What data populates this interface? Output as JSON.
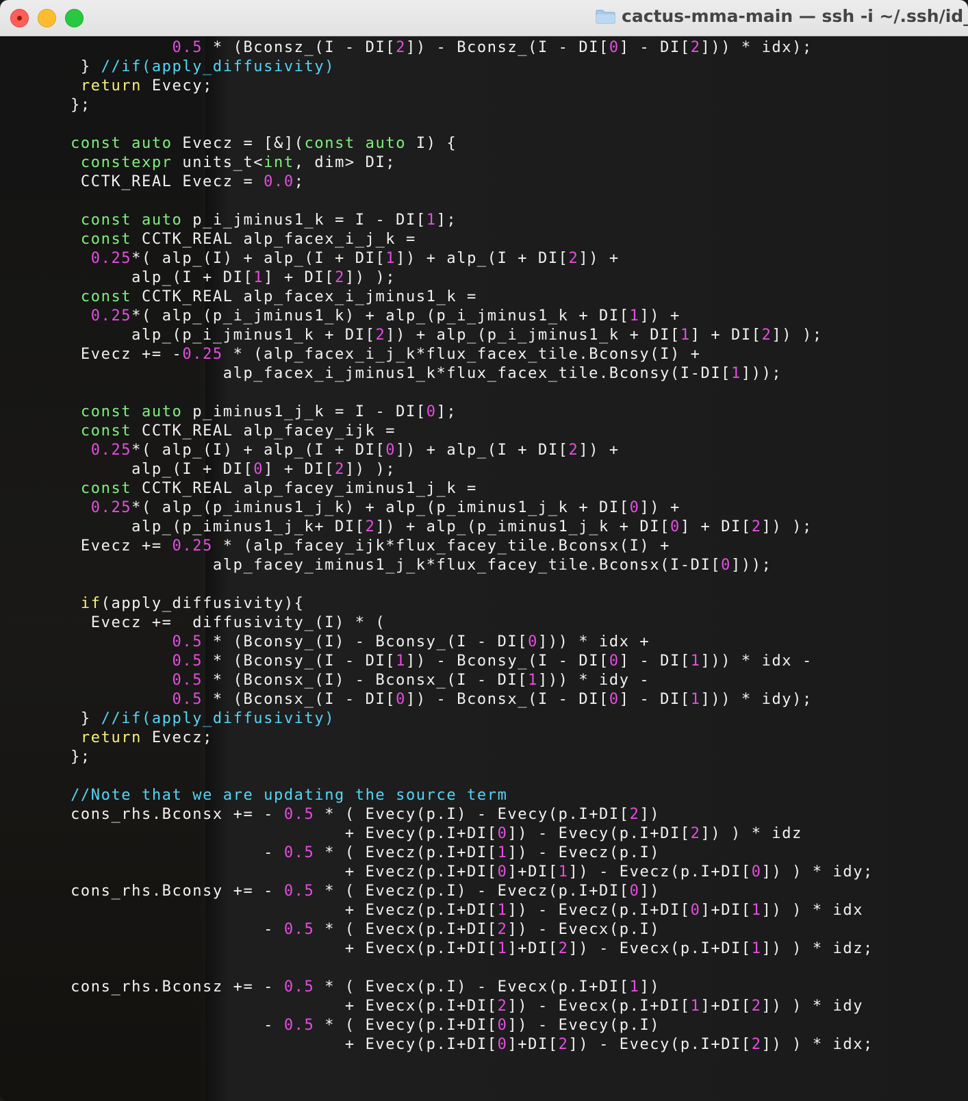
{
  "window": {
    "title": "cactus-mma-main — ssh -i ~/.ssh/id_ec",
    "icon": "folder-icon"
  },
  "code_lines": [
    [
      [
        "                ",
        ""
      ],
      [
        "0.5",
        "n"
      ],
      [
        " * (Bconsz_(I - DI[",
        ""
      ],
      [
        "2",
        "n"
      ],
      [
        "]) - Bconsz_(I - DI[",
        ""
      ],
      [
        "0",
        "n"
      ],
      [
        "] - DI[",
        ""
      ],
      [
        "2",
        "n"
      ],
      [
        "])) * idx);",
        ""
      ]
    ],
    [
      [
        "       } ",
        ""
      ],
      [
        "//if(apply_diffusivity)",
        "c"
      ]
    ],
    [
      [
        "       ",
        ""
      ],
      [
        "return",
        "k"
      ],
      [
        " Evecy;",
        ""
      ]
    ],
    [
      [
        "      };",
        ""
      ]
    ],
    [
      [
        "",
        ""
      ]
    ],
    [
      [
        "      ",
        ""
      ],
      [
        "const",
        "t"
      ],
      [
        " ",
        ""
      ],
      [
        "auto",
        "t"
      ],
      [
        " Evecz = [&](",
        ""
      ],
      [
        "const",
        "t"
      ],
      [
        " ",
        ""
      ],
      [
        "auto",
        "t"
      ],
      [
        " I) {",
        ""
      ]
    ],
    [
      [
        "       ",
        ""
      ],
      [
        "constexpr",
        "t"
      ],
      [
        " units_t<",
        ""
      ],
      [
        "int",
        "t"
      ],
      [
        ", dim> DI;",
        ""
      ]
    ],
    [
      [
        "       CCTK_REAL Evecz = ",
        ""
      ],
      [
        "0.0",
        "n"
      ],
      [
        ";",
        ""
      ]
    ],
    [
      [
        "",
        ""
      ]
    ],
    [
      [
        "       ",
        ""
      ],
      [
        "const",
        "t"
      ],
      [
        " ",
        ""
      ],
      [
        "auto",
        "t"
      ],
      [
        " p_i_jminus1_k = I - DI[",
        ""
      ],
      [
        "1",
        "n"
      ],
      [
        "];",
        ""
      ]
    ],
    [
      [
        "       ",
        ""
      ],
      [
        "const",
        "t"
      ],
      [
        " CCTK_REAL alp_facex_i_j_k =",
        ""
      ]
    ],
    [
      [
        "        ",
        ""
      ],
      [
        "0.25",
        "n"
      ],
      [
        "*( alp_(I) + alp_(I + DI[",
        ""
      ],
      [
        "1",
        "n"
      ],
      [
        "]) + alp_(I + DI[",
        ""
      ],
      [
        "2",
        "n"
      ],
      [
        "]) +",
        ""
      ]
    ],
    [
      [
        "            alp_(I + DI[",
        ""
      ],
      [
        "1",
        "n"
      ],
      [
        "] + DI[",
        ""
      ],
      [
        "2",
        "n"
      ],
      [
        "]) );",
        ""
      ]
    ],
    [
      [
        "       ",
        ""
      ],
      [
        "const",
        "t"
      ],
      [
        " CCTK_REAL alp_facex_i_jminus1_k =",
        ""
      ]
    ],
    [
      [
        "        ",
        ""
      ],
      [
        "0.25",
        "n"
      ],
      [
        "*( alp_(p_i_jminus1_k) + alp_(p_i_jminus1_k + DI[",
        ""
      ],
      [
        "1",
        "n"
      ],
      [
        "]) +",
        ""
      ]
    ],
    [
      [
        "            alp_(p_i_jminus1_k + DI[",
        ""
      ],
      [
        "2",
        "n"
      ],
      [
        "]) + alp_(p_i_jminus1_k + DI[",
        ""
      ],
      [
        "1",
        "n"
      ],
      [
        "] + DI[",
        ""
      ],
      [
        "2",
        "n"
      ],
      [
        "]) );",
        ""
      ]
    ],
    [
      [
        "       Evecz += -",
        ""
      ],
      [
        "0.25",
        "n"
      ],
      [
        " * (alp_facex_i_j_k*flux_facex_tile.Bconsy(I) +",
        ""
      ]
    ],
    [
      [
        "                     alp_facex_i_jminus1_k*flux_facex_tile.Bconsy(I-DI[",
        ""
      ],
      [
        "1",
        "n"
      ],
      [
        "]));",
        ""
      ]
    ],
    [
      [
        "",
        ""
      ]
    ],
    [
      [
        "       ",
        ""
      ],
      [
        "const",
        "t"
      ],
      [
        " ",
        ""
      ],
      [
        "auto",
        "t"
      ],
      [
        " p_iminus1_j_k = I - DI[",
        ""
      ],
      [
        "0",
        "n"
      ],
      [
        "];",
        ""
      ]
    ],
    [
      [
        "       ",
        ""
      ],
      [
        "const",
        "t"
      ],
      [
        " CCTK_REAL alp_facey_ijk =",
        ""
      ]
    ],
    [
      [
        "        ",
        ""
      ],
      [
        "0.25",
        "n"
      ],
      [
        "*( alp_(I) + alp_(I + DI[",
        ""
      ],
      [
        "0",
        "n"
      ],
      [
        "]) + alp_(I + DI[",
        ""
      ],
      [
        "2",
        "n"
      ],
      [
        "]) +",
        ""
      ]
    ],
    [
      [
        "            alp_(I + DI[",
        ""
      ],
      [
        "0",
        "n"
      ],
      [
        "] + DI[",
        ""
      ],
      [
        "2",
        "n"
      ],
      [
        "]) );",
        ""
      ]
    ],
    [
      [
        "       ",
        ""
      ],
      [
        "const",
        "t"
      ],
      [
        " CCTK_REAL alp_facey_iminus1_j_k =",
        ""
      ]
    ],
    [
      [
        "        ",
        ""
      ],
      [
        "0.25",
        "n"
      ],
      [
        "*( alp_(p_iminus1_j_k) + alp_(p_iminus1_j_k + DI[",
        ""
      ],
      [
        "0",
        "n"
      ],
      [
        "]) +",
        ""
      ]
    ],
    [
      [
        "            alp_(p_iminus1_j_k+ DI[",
        ""
      ],
      [
        "2",
        "n"
      ],
      [
        "]) + alp_(p_iminus1_j_k + DI[",
        ""
      ],
      [
        "0",
        "n"
      ],
      [
        "] + DI[",
        ""
      ],
      [
        "2",
        "n"
      ],
      [
        "]) );",
        ""
      ]
    ],
    [
      [
        "       Evecz += ",
        ""
      ],
      [
        "0.25",
        "n"
      ],
      [
        " * (alp_facey_ijk*flux_facey_tile.Bconsx(I) +",
        ""
      ]
    ],
    [
      [
        "                    alp_facey_iminus1_j_k*flux_facey_tile.Bconsx(I-DI[",
        ""
      ],
      [
        "0",
        "n"
      ],
      [
        "]));",
        ""
      ]
    ],
    [
      [
        "",
        ""
      ]
    ],
    [
      [
        "       ",
        ""
      ],
      [
        "if",
        "k"
      ],
      [
        "(apply_diffusivity){",
        ""
      ]
    ],
    [
      [
        "        Evecz +=  diffusivity_(I) * (",
        ""
      ]
    ],
    [
      [
        "                ",
        ""
      ],
      [
        "0.5",
        "n"
      ],
      [
        " * (Bconsy_(I) - Bconsy_(I - DI[",
        ""
      ],
      [
        "0",
        "n"
      ],
      [
        "])) * idx +",
        ""
      ]
    ],
    [
      [
        "                ",
        ""
      ],
      [
        "0.5",
        "n"
      ],
      [
        " * (Bconsy_(I - DI[",
        ""
      ],
      [
        "1",
        "n"
      ],
      [
        "]) - Bconsy_(I - DI[",
        ""
      ],
      [
        "0",
        "n"
      ],
      [
        "] - DI[",
        ""
      ],
      [
        "1",
        "n"
      ],
      [
        "])) * idx -",
        ""
      ]
    ],
    [
      [
        "                ",
        ""
      ],
      [
        "0.5",
        "n"
      ],
      [
        " * (Bconsx_(I) - Bconsx_(I - DI[",
        ""
      ],
      [
        "1",
        "n"
      ],
      [
        "])) * idy -",
        ""
      ]
    ],
    [
      [
        "                ",
        ""
      ],
      [
        "0.5",
        "n"
      ],
      [
        " * (Bconsx_(I - DI[",
        ""
      ],
      [
        "0",
        "n"
      ],
      [
        "]) - Bconsx_(I - DI[",
        ""
      ],
      [
        "0",
        "n"
      ],
      [
        "] - DI[",
        ""
      ],
      [
        "1",
        "n"
      ],
      [
        "])) * idy);",
        ""
      ]
    ],
    [
      [
        "       } ",
        ""
      ],
      [
        "//if(apply_diffusivity)",
        "c"
      ]
    ],
    [
      [
        "       ",
        ""
      ],
      [
        "return",
        "k"
      ],
      [
        " Evecz;",
        ""
      ]
    ],
    [
      [
        "      };",
        ""
      ]
    ],
    [
      [
        "",
        ""
      ]
    ],
    [
      [
        "      ",
        ""
      ],
      [
        "//Note that we are updating the source term",
        "c"
      ]
    ],
    [
      [
        "      cons_rhs.Bconsx += - ",
        ""
      ],
      [
        "0.5",
        "n"
      ],
      [
        " * ( Evecy(p.I) - Evecy(p.I+DI[",
        ""
      ],
      [
        "2",
        "n"
      ],
      [
        "])",
        ""
      ]
    ],
    [
      [
        "                                 + Evecy(p.I+DI[",
        ""
      ],
      [
        "0",
        "n"
      ],
      [
        "]) - Evecy(p.I+DI[",
        ""
      ],
      [
        "2",
        "n"
      ],
      [
        "]) ) * idz",
        ""
      ]
    ],
    [
      [
        "                         - ",
        ""
      ],
      [
        "0.5",
        "n"
      ],
      [
        " * ( Evecz(p.I+DI[",
        ""
      ],
      [
        "1",
        "n"
      ],
      [
        "]) - Evecz(p.I)",
        ""
      ]
    ],
    [
      [
        "                                 + Evecz(p.I+DI[",
        ""
      ],
      [
        "0",
        "n"
      ],
      [
        "]+DI[",
        ""
      ],
      [
        "1",
        "n"
      ],
      [
        "]) - Evecz(p.I+DI[",
        ""
      ],
      [
        "0",
        "n"
      ],
      [
        "]) ) * idy;",
        ""
      ]
    ],
    [
      [
        "      cons_rhs.Bconsy += - ",
        ""
      ],
      [
        "0.5",
        "n"
      ],
      [
        " * ( Evecz(p.I) - Evecz(p.I+DI[",
        ""
      ],
      [
        "0",
        "n"
      ],
      [
        "])",
        ""
      ]
    ],
    [
      [
        "                                 + Evecz(p.I+DI[",
        ""
      ],
      [
        "1",
        "n"
      ],
      [
        "]) - Evecz(p.I+DI[",
        ""
      ],
      [
        "0",
        "n"
      ],
      [
        "]+DI[",
        ""
      ],
      [
        "1",
        "n"
      ],
      [
        "]) ) * idx",
        ""
      ]
    ],
    [
      [
        "                         - ",
        ""
      ],
      [
        "0.5",
        "n"
      ],
      [
        " * ( Evecx(p.I+DI[",
        ""
      ],
      [
        "2",
        "n"
      ],
      [
        "]) - Evecx(p.I)",
        ""
      ]
    ],
    [
      [
        "                                 + Evecx(p.I+DI[",
        ""
      ],
      [
        "1",
        "n"
      ],
      [
        "]+DI[",
        ""
      ],
      [
        "2",
        "n"
      ],
      [
        "]) - Evecx(p.I+DI[",
        ""
      ],
      [
        "1",
        "n"
      ],
      [
        "]) ) * idz;",
        ""
      ]
    ],
    [
      [
        "",
        ""
      ]
    ],
    [
      [
        "      cons_rhs.Bconsz += - ",
        ""
      ],
      [
        "0.5",
        "n"
      ],
      [
        " * ( Evecx(p.I) - Evecx(p.I+DI[",
        ""
      ],
      [
        "1",
        "n"
      ],
      [
        "])",
        ""
      ]
    ],
    [
      [
        "                                 + Evecx(p.I+DI[",
        ""
      ],
      [
        "2",
        "n"
      ],
      [
        "]) - Evecx(p.I+DI[",
        ""
      ],
      [
        "1",
        "n"
      ],
      [
        "]+DI[",
        ""
      ],
      [
        "2",
        "n"
      ],
      [
        "]) ) * idy",
        ""
      ]
    ],
    [
      [
        "                         - ",
        ""
      ],
      [
        "0.5",
        "n"
      ],
      [
        " * ( Evecy(p.I+DI[",
        ""
      ],
      [
        "0",
        "n"
      ],
      [
        "]) - Evecy(p.I)",
        ""
      ]
    ],
    [
      [
        "                                 + Evecy(p.I+DI[",
        ""
      ],
      [
        "0",
        "n"
      ],
      [
        "]+DI[",
        ""
      ],
      [
        "2",
        "n"
      ],
      [
        "]) - Evecy(p.I+DI[",
        ""
      ],
      [
        "2",
        "n"
      ],
      [
        "]) ) * idx;",
        ""
      ]
    ]
  ]
}
